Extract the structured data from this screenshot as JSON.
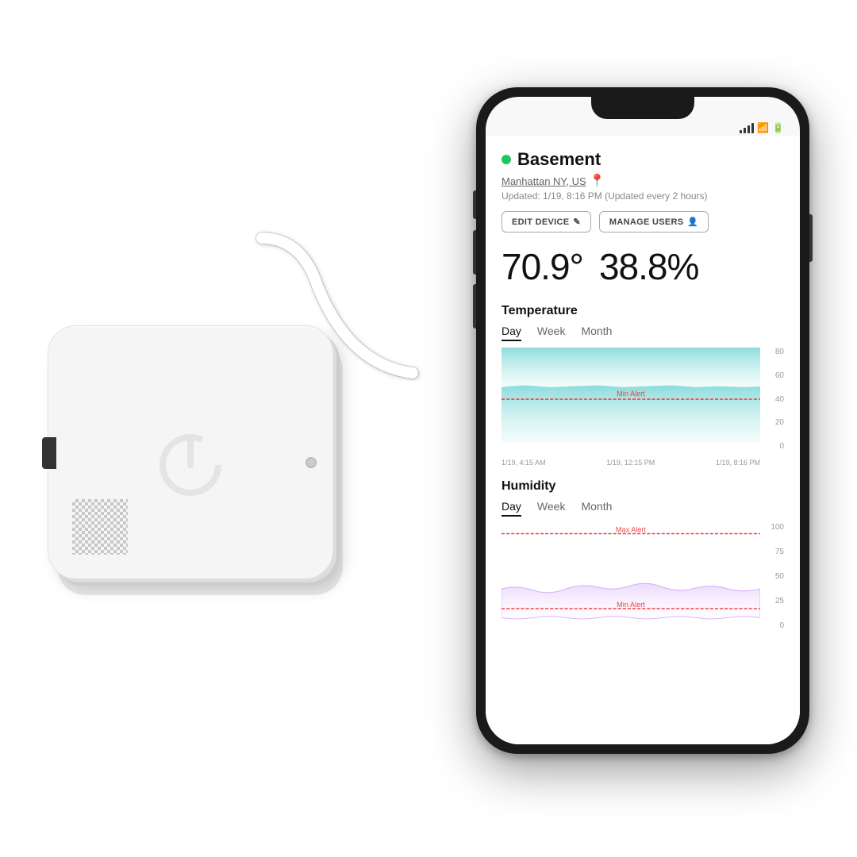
{
  "app": {
    "title": "Basement",
    "online_status": "online",
    "location": "Manhattan NY, US",
    "updated_text": "Updated: 1/19, 8:16 PM (Updated every 2 hours)",
    "edit_device_label": "EDIT DEVICE",
    "manage_users_label": "MANAGE USERS",
    "temperature": {
      "value": "70.9",
      "unit": "°",
      "label": "Temperature"
    },
    "humidity": {
      "value": "38.8%",
      "label": "Humidity"
    },
    "temp_chart": {
      "title": "Temperature",
      "tabs": [
        "Day",
        "Week",
        "Month"
      ],
      "active_tab": "Day",
      "min_alert_label": "Min Alert",
      "y_labels": [
        "80",
        "60",
        "40",
        "20",
        "0"
      ],
      "x_labels": [
        "1/19, 4:15 AM",
        "1/19, 12:15 PM",
        "1/19, 8:16 PM"
      ]
    },
    "humidity_chart": {
      "title": "Humidity",
      "tabs": [
        "Day",
        "Week",
        "Month"
      ],
      "active_tab": "Day",
      "max_alert_label": "Max Alert",
      "min_alert_label": "Min Alert",
      "y_labels": [
        "100",
        "75",
        "50",
        "25",
        "0"
      ]
    }
  },
  "colors": {
    "online": "#22c55e",
    "temp_fill_top": "#80d8d8",
    "temp_fill_bottom": "#e0f7f7",
    "humidity_fill": "#e8d5f5",
    "alert_line": "#ef4444",
    "accent": "#111111"
  }
}
